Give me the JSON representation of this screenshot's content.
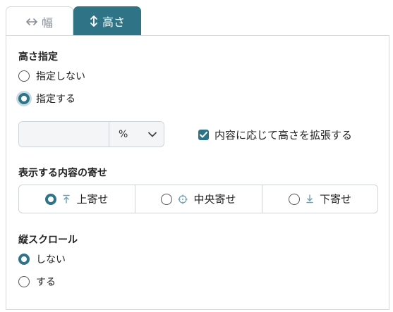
{
  "tabs": {
    "width_label": "幅",
    "height_label": "高さ"
  },
  "height_spec": {
    "title": "高さ指定",
    "options": [
      {
        "label": "指定しない",
        "selected": false
      },
      {
        "label": "指定する",
        "selected": true
      }
    ],
    "value": "",
    "unit": "%",
    "expand_checkbox": {
      "label": "内容に応じて高さを拡張する",
      "checked": true
    }
  },
  "alignment": {
    "title": "表示する内容の寄せ",
    "options": [
      {
        "label": "上寄せ",
        "icon": "arrow-to-top-icon",
        "selected": true
      },
      {
        "label": "中央寄せ",
        "icon": "crosshair-center-icon",
        "selected": false
      },
      {
        "label": "下寄せ",
        "icon": "arrow-to-bottom-icon",
        "selected": false
      }
    ]
  },
  "vertical_scroll": {
    "title": "縦スクロール",
    "options": [
      {
        "label": "しない",
        "selected": true
      },
      {
        "label": "する",
        "selected": false
      }
    ]
  },
  "colors": {
    "accent": "#2f7486",
    "muted_icon": "#6f9fb0",
    "border": "#cfd4d9"
  }
}
